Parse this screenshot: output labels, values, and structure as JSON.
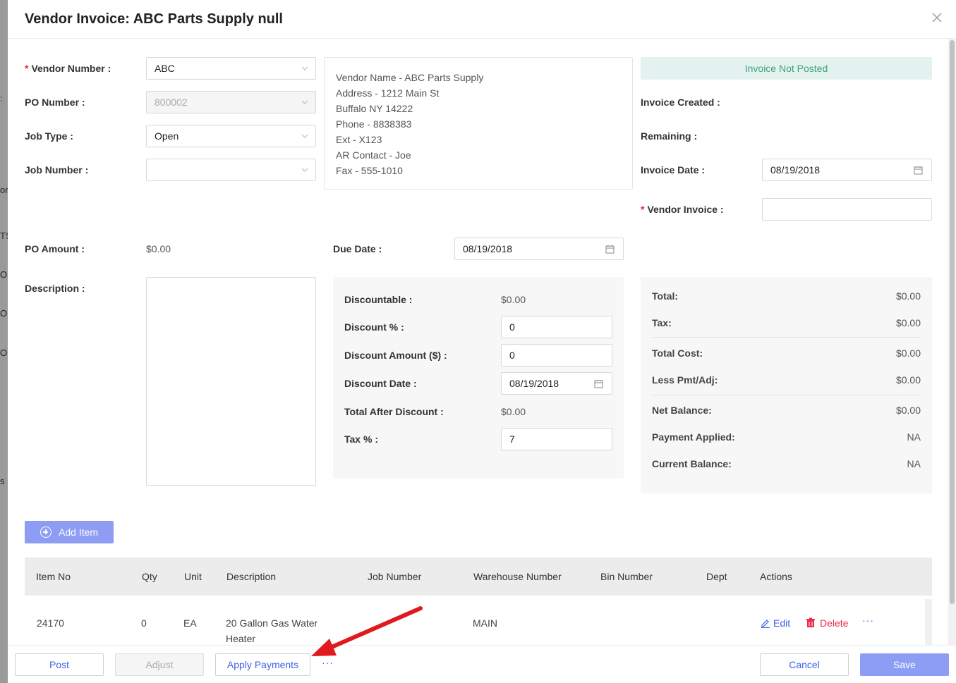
{
  "background": {
    "fragments": [
      ":",
      "or",
      "TS",
      "O",
      "O",
      "OR",
      "s"
    ]
  },
  "modal": {
    "title": "Vendor Invoice: ABC Parts Supply null",
    "close_icon": "close-icon"
  },
  "form": {
    "vendor_number": {
      "label": "Vendor Number",
      "value": "ABC",
      "required": true
    },
    "po_number": {
      "label": "PO Number",
      "value": "800002"
    },
    "job_type": {
      "label": "Job Type",
      "value": "Open"
    },
    "job_number": {
      "label": "Job Number",
      "value": ""
    },
    "po_amount": {
      "label": "PO Amount",
      "value": "$0.00"
    },
    "due_date": {
      "label": "Due Date",
      "value": "08/19/2018"
    },
    "description": {
      "label": "Description",
      "value": ""
    }
  },
  "vendor_info": [
    "Vendor Name - ABC Parts Supply",
    "Address - 1212 Main St",
    "Buffalo NY 14222",
    "Phone - 8838383",
    "Ext - X123",
    "AR Contact - Joe",
    "Fax - 555-1010"
  ],
  "status": {
    "text": "Invoice Not Posted",
    "color": "#3aa37a"
  },
  "invoice": {
    "created_label": "Invoice Created",
    "remaining_label": "Remaining",
    "date_label": "Invoice Date",
    "date_value": "08/19/2018",
    "vendor_invoice_label": "Vendor Invoice",
    "vendor_invoice_value": ""
  },
  "discount": {
    "discountable_label": "Discountable",
    "discountable_value": "$0.00",
    "discount_pct_label": "Discount %",
    "discount_pct_value": "0",
    "discount_amount_label": "Discount Amount ($)",
    "discount_amount_value": "0",
    "discount_date_label": "Discount Date",
    "discount_date_value": "08/19/2018",
    "total_after_label": "Total After Discount",
    "total_after_value": "$0.00",
    "tax_pct_label": "Tax %",
    "tax_pct_value": "7"
  },
  "summary": [
    {
      "label": "Total:",
      "value": "$0.00"
    },
    {
      "label": "Tax:",
      "value": "$0.00"
    },
    {
      "label": "Total Cost:",
      "value": "$0.00"
    },
    {
      "label": "Less Pmt/Adj:",
      "value": "$0.00"
    },
    {
      "label": "Net Balance:",
      "value": "$0.00"
    },
    {
      "label": "Payment Applied:",
      "value": "NA"
    },
    {
      "label": "Current Balance:",
      "value": "NA"
    }
  ],
  "add_item_label": "Add Item",
  "table": {
    "headers": [
      "Item No",
      "Qty",
      "Unit",
      "Description",
      "Job Number",
      "Warehouse Number",
      "Bin Number",
      "Dept",
      "Actions"
    ],
    "rows": [
      {
        "item_no": "24170",
        "qty": "0",
        "unit": "EA",
        "description_1": "20 Gallon Gas Water",
        "description_2": "Heater",
        "job_number": "",
        "warehouse": "MAIN",
        "bin": "",
        "dept": "",
        "edit": "Edit",
        "delete": "Delete",
        "more": "···"
      }
    ]
  },
  "footer": {
    "post": "Post",
    "adjust": "Adjust",
    "apply_payments": "Apply Payments",
    "more": "···",
    "cancel": "Cancel",
    "save": "Save"
  },
  "colors": {
    "accent": "#3c61e6",
    "primary_button": "#8c9df3",
    "danger": "#ee2a4e",
    "annotation_arrow": "#e0191e"
  }
}
